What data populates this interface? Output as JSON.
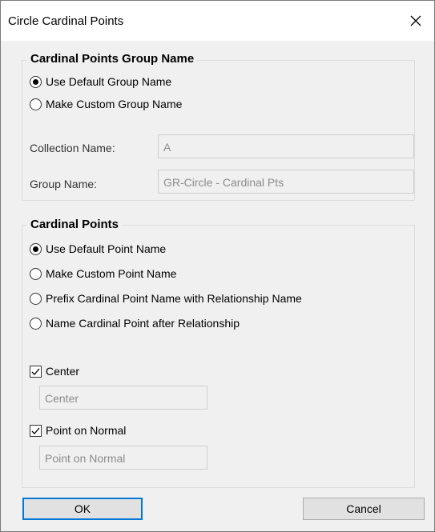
{
  "window": {
    "title": "Circle Cardinal Points"
  },
  "group_section": {
    "legend": "Cardinal Points Group Name",
    "options": [
      "Use Default Group Name",
      "Make Custom Group Name"
    ],
    "selected_option": "Use Default Group Name",
    "collection_label": "Collection Name:",
    "collection_value": "A",
    "group_label": "Group Name:",
    "group_value": "GR-Circle - Cardinal Pts"
  },
  "points_section": {
    "legend": "Cardinal Points",
    "options": [
      "Use Default Point Name",
      "Make Custom Point Name",
      "Prefix Cardinal Point Name with Relationship Name",
      "Name Cardinal Point after Relationship"
    ],
    "selected_option": "Use Default Point Name",
    "center": {
      "label": "Center",
      "checked": true,
      "value": "Center"
    },
    "point_on_normal": {
      "label": "Point on Normal",
      "checked": true,
      "value": "Point on Normal"
    }
  },
  "buttons": {
    "ok": "OK",
    "cancel": "Cancel"
  }
}
